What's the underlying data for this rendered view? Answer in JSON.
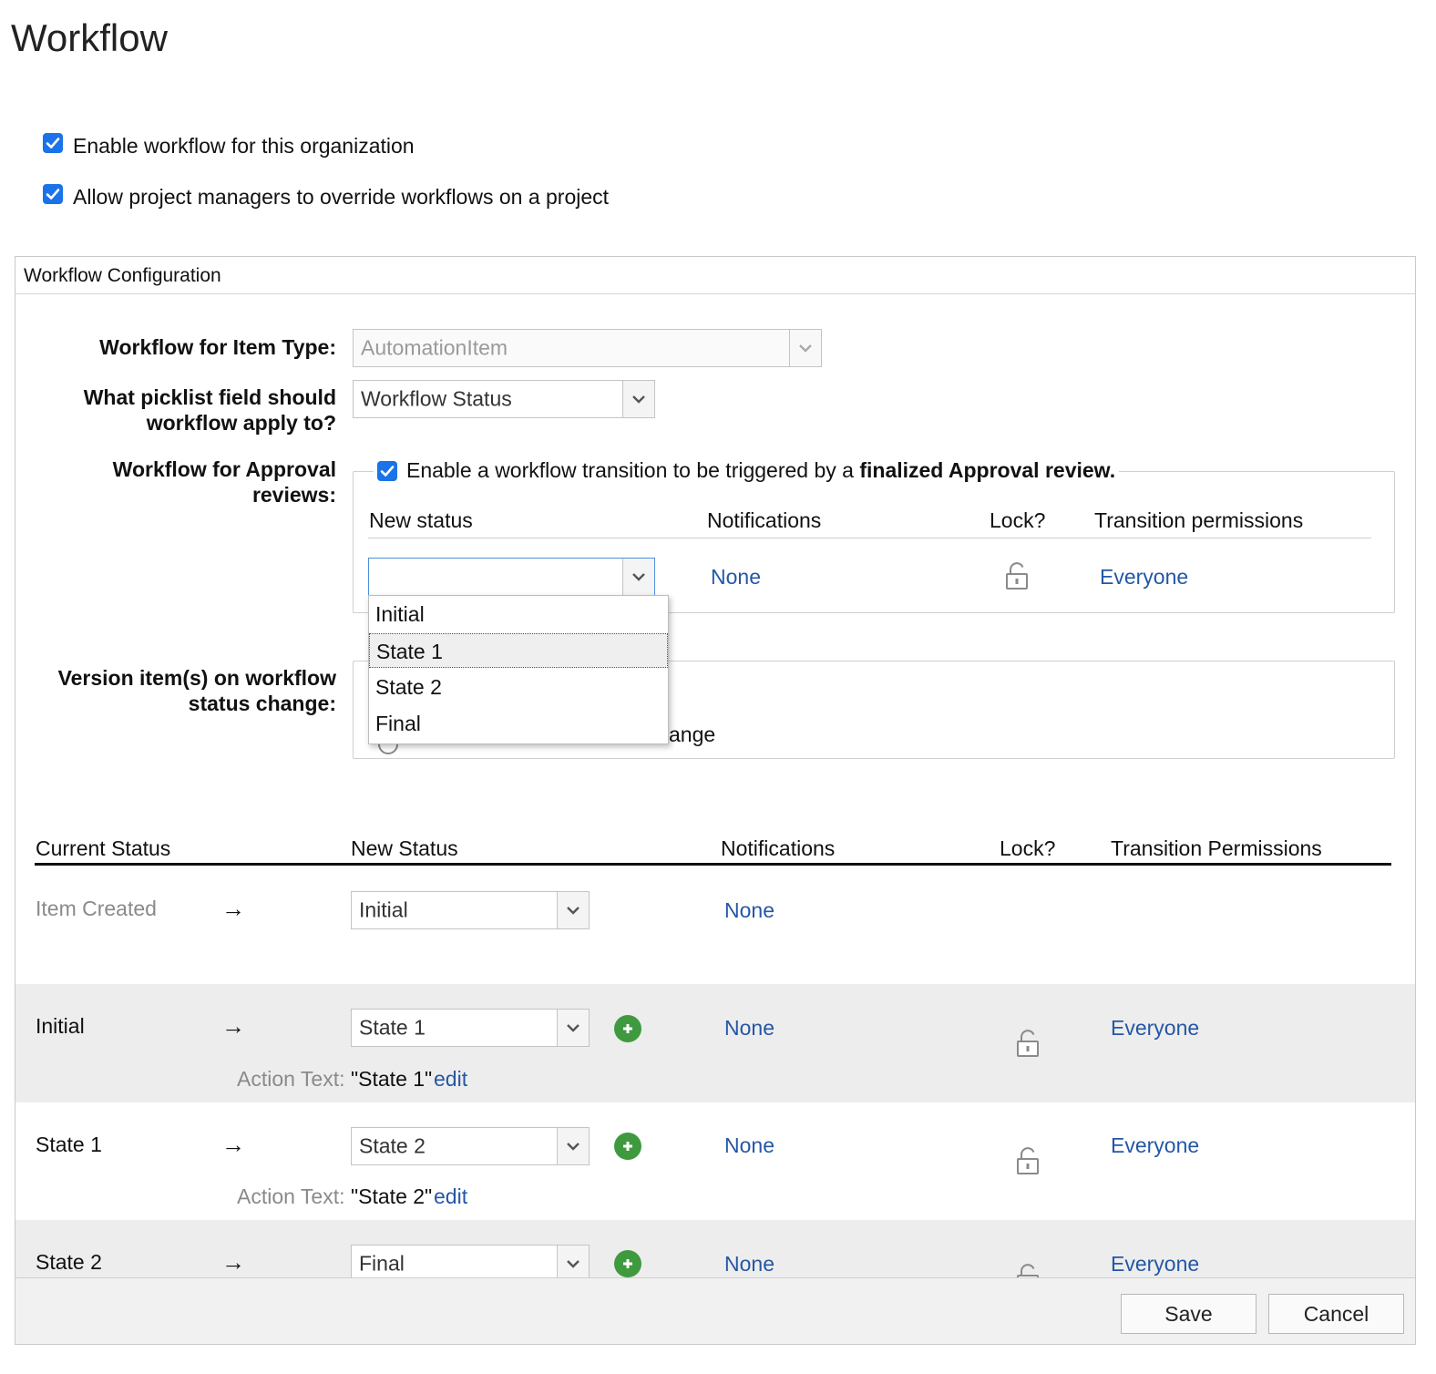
{
  "page": {
    "title": "Workflow"
  },
  "settings": {
    "enable_workflow": {
      "label": "Enable workflow for this organization",
      "checked": true
    },
    "allow_override": {
      "label": "Allow project managers to override workflows on a project",
      "checked": true
    }
  },
  "config": {
    "header": "Workflow Configuration",
    "item_type": {
      "label": "Workflow for Item Type:",
      "value": "AutomationItem",
      "disabled": true
    },
    "picklist": {
      "label_line1": "What picklist field should",
      "label_line2": "workflow apply to?",
      "value": "Workflow Status"
    },
    "approval": {
      "label_line1": "Workflow for Approval",
      "label_line2": "reviews:",
      "checkbox_text": "Enable a workflow transition to be triggered by a ",
      "checkbox_bold": "finalized Approval review.",
      "checked": true,
      "columns": {
        "new_status": "New status",
        "notifications": "Notifications",
        "lock": "Lock?",
        "permissions": "Transition permissions"
      },
      "new_status_value": "",
      "notifications_value": "None",
      "permissions_value": "Everyone",
      "dropdown_options": [
        "Initial",
        "State 1",
        "State 2",
        "Final"
      ],
      "dropdown_highlighted": "State 1"
    },
    "versioning": {
      "label_line1": "Version item(s) on workflow",
      "label_line2": "status change:",
      "partial_option_text": "ange"
    }
  },
  "transitions": {
    "columns": {
      "current": "Current Status",
      "new": "New Status",
      "notifications": "Notifications",
      "lock": "Lock?",
      "permissions": "Transition Permissions"
    },
    "arrow": "→",
    "action_text_label": "Action Text:",
    "edit_label": "edit",
    "rows": [
      {
        "current": "Item Created",
        "new": "Initial",
        "notifications": "None",
        "permissions": "",
        "action_text": ""
      },
      {
        "current": "Initial",
        "new": "State 1",
        "notifications": "None",
        "permissions": "Everyone",
        "action_text": "\"State 1\""
      },
      {
        "current": "State 1",
        "new": "State 2",
        "notifications": "None",
        "permissions": "Everyone",
        "action_text": "\"State 2\""
      },
      {
        "current": "State 2",
        "new": "Final",
        "notifications": "None",
        "permissions": "Everyone",
        "action_text": ""
      }
    ]
  },
  "footer": {
    "save": "Save",
    "cancel": "Cancel"
  },
  "colors": {
    "checkbox": "#1a73e8",
    "link": "#2457a6",
    "add": "#3f9a3f",
    "row_band": "#ededed"
  }
}
